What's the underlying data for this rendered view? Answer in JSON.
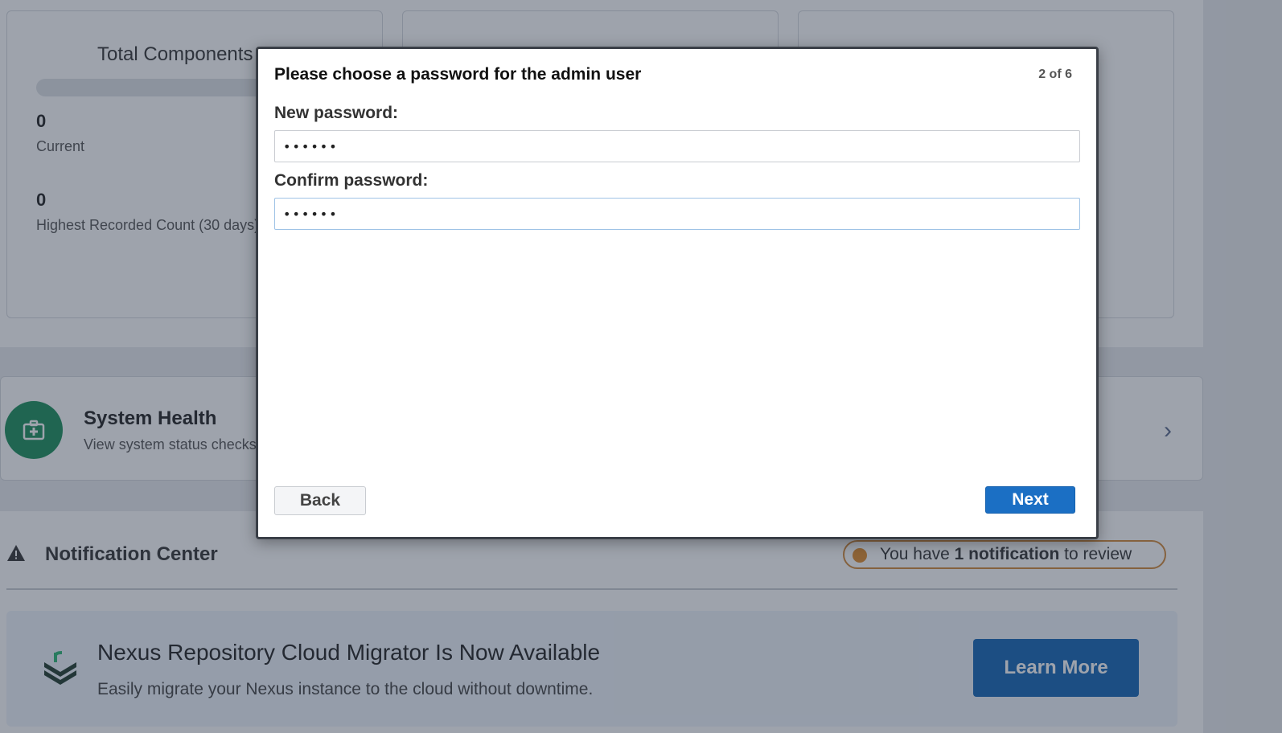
{
  "dashboard": {
    "components_card": {
      "title": "Total Components",
      "current_value": "0",
      "current_label": "Current",
      "highest_value": "0",
      "highest_label": "Highest Recorded Count (30 days)"
    },
    "system_health": {
      "title": "System Health",
      "subtitle": "View system status checks",
      "icon": "first-aid-kit-icon",
      "accent": "#1a8f5a"
    },
    "notification_center": {
      "title": "Notification Center",
      "badge_prefix": "You have ",
      "badge_bold": "1 notification",
      "badge_suffix": " to review",
      "badge_color": "#e08a2a",
      "promo": {
        "title": "Nexus Repository Cloud Migrator Is Now Available",
        "subtitle": "Easily migrate your Nexus instance to the cloud without downtime.",
        "button_label": "Learn More",
        "button_color": "#1365b4"
      }
    }
  },
  "modal": {
    "title": "Please choose a password for the admin user",
    "step": "2 of 6",
    "new_password_label": "New password:",
    "new_password_value": "••••••",
    "confirm_password_label": "Confirm password:",
    "confirm_password_value": "••••••",
    "back_label": "Back",
    "next_label": "Next",
    "next_color": "#1b6fc4"
  }
}
